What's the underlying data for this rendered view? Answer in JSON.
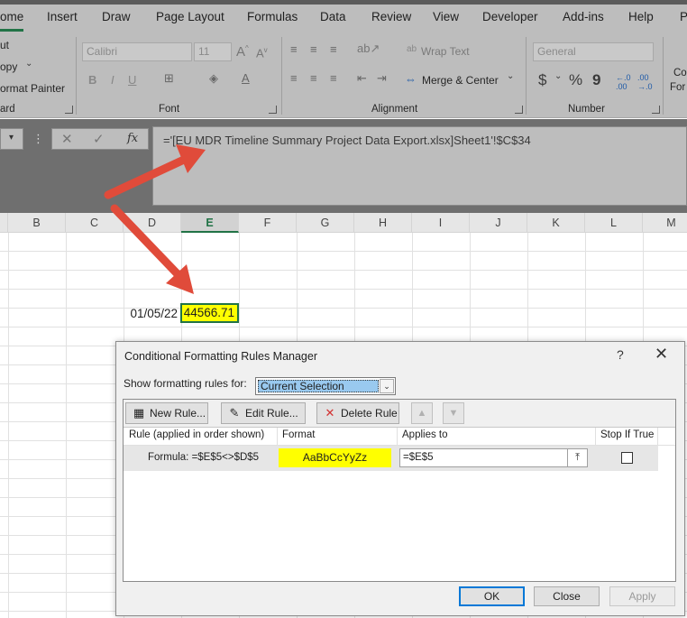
{
  "ribbon_tabs": [
    "ome",
    "Insert",
    "Draw",
    "Page Layout",
    "Formulas",
    "Data",
    "Review",
    "View",
    "Developer",
    "Add-ins",
    "Help",
    "P"
  ],
  "clipboard": {
    "cut": "ut",
    "copy": "opy",
    "format_painter": "ormat Painter",
    "label": "ard"
  },
  "font": {
    "name": "Calibri",
    "size": "11",
    "label": "Font",
    "bold": "B",
    "italic": "I",
    "underline": "U"
  },
  "alignment": {
    "wrap_text": "Wrap Text",
    "merge_center": "Merge & Center",
    "label": "Alignment"
  },
  "number": {
    "format": "General",
    "label": "Number",
    "currency": "$",
    "percent": "%",
    "comma": "9"
  },
  "styles_partial": {
    "line1": "Co",
    "line2": "For"
  },
  "formula_bar": {
    "fx": "fx",
    "content": "='[EU MDR Timeline Summary Project Data Export.xlsx]Sheet1'!$C$34"
  },
  "columns": [
    "B",
    "C",
    "D",
    "E",
    "F",
    "G",
    "H",
    "I",
    "J",
    "K",
    "L",
    "M"
  ],
  "cells": {
    "d_value": "01/05/22",
    "e_value": "44566.71"
  },
  "dialog": {
    "title": "Conditional Formatting Rules Manager",
    "help": "?",
    "close": "✕",
    "show_label": "Show formatting rules for:",
    "show_value": "Current Selection",
    "new_rule": "New Rule...",
    "edit_rule": "Edit Rule...",
    "delete_rule": "Delete Rule",
    "headers": {
      "rule": "Rule (applied in order shown)",
      "format": "Format",
      "applies": "Applies to",
      "stop": "Stop If True"
    },
    "row": {
      "rule": "Formula: =$E$5<>$D$5",
      "format_preview": "AaBbCcYyZz",
      "applies": "=$E$5"
    },
    "ok": "OK",
    "close_btn": "Close",
    "apply": "Apply"
  },
  "colors": {
    "accent": "#217346",
    "highlight": "#ffff00",
    "arrow": "#e04b3a",
    "focus": "#0078d7"
  }
}
